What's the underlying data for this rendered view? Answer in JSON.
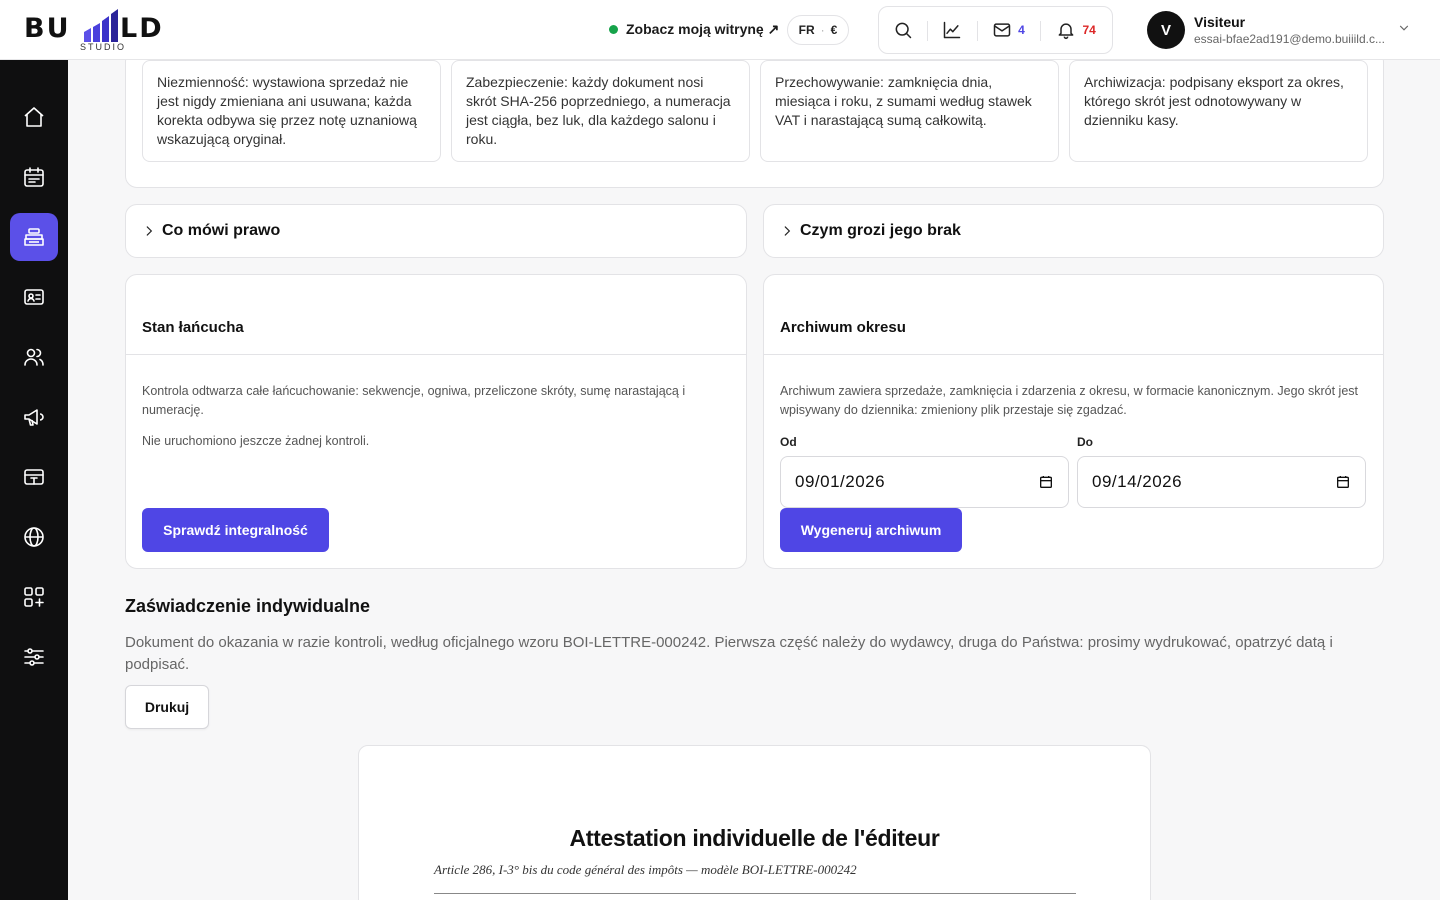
{
  "brand": {
    "logo_left": "BU",
    "logo_right": "LD",
    "logo_sub": "STUDIO",
    "bar_colors": [
      "#5b50e8",
      "#5b50e8",
      "#3b33c9",
      "#2a2399"
    ]
  },
  "header": {
    "site_link": "Zobacz moją witrynę ↗",
    "lang": "FR",
    "currency": "€",
    "messages_count": "4",
    "notifications_count": "74",
    "user_initial": "V",
    "user_name": "Visiteur",
    "user_email": "essai-bfae2ad191@demo.buiiild.c..."
  },
  "sidebar": {
    "active_color": "#5b50e8",
    "items": [
      {
        "icon": "home-icon"
      },
      {
        "icon": "calendar-icon"
      },
      {
        "icon": "cash-register-icon",
        "active": true
      },
      {
        "icon": "id-card-icon"
      },
      {
        "icon": "users-icon"
      },
      {
        "icon": "megaphone-icon"
      },
      {
        "icon": "card-icon"
      },
      {
        "icon": "globe-icon"
      },
      {
        "icon": "apps-add-icon"
      },
      {
        "icon": "sliders-icon"
      }
    ]
  },
  "principles": [
    "Niezmienność: wystawiona sprzedaż nie jest nigdy zmieniana ani usuwana; każda korekta odbywa się przez notę uznaniową wskazującą oryginał.",
    "Zabezpieczenie: każdy dokument nosi skrót SHA-256 poprzedniego, a numeracja jest ciągła, bez luk, dla każdego salonu i roku.",
    "Przechowywanie: zamknięcia dnia, miesiąca i roku, z sumami według stawek VAT i narastającą sumą całkowitą.",
    "Archiwizacja: podpisany eksport za okres, którego skrót jest odnotowywany w dzienniku kasy."
  ],
  "accordions": {
    "law": "Co mówi prawo",
    "risk": "Czym grozi jego brak"
  },
  "chain": {
    "title": "Stan łańcucha",
    "desc": "Kontrola odtwarza całe łańcuchowanie: sekwencje, ogniwa, przeliczone skróty, sumę narastającą i numerację.",
    "status": "Nie uruchomiono jeszcze żadnej kontroli.",
    "button": "Sprawdź integralność"
  },
  "archive": {
    "title": "Archiwum okresu",
    "desc": "Archiwum zawiera sprzedaże, zamknięcia i zdarzenia z okresu, w formacie kanonicznym. Jego skrót jest wpisywany do dziennika: zmieniony plik przestaje się zgadzać.",
    "from_label": "Od",
    "from_value": "09/01/2026",
    "to_label": "Do",
    "to_value": "09/14/2026",
    "button": "Wygeneruj archiwum"
  },
  "certificate": {
    "title": "Zaświadczenie indywidualne",
    "desc": "Dokument do okazania w razie kontroli, według oficjalnego wzoru BOI-LETTRE-000242. Pierwsza część należy do wydawcy, druga do Państwa: prosimy wydrukować, opatrzyć datą i podpisać.",
    "print_button": "Drukuj",
    "doc_title": "Attestation individuelle de l'éditeur",
    "doc_subtitle": "Article 286, I-3° bis du code général des impôts — modèle BOI-LETTRE-000242"
  }
}
